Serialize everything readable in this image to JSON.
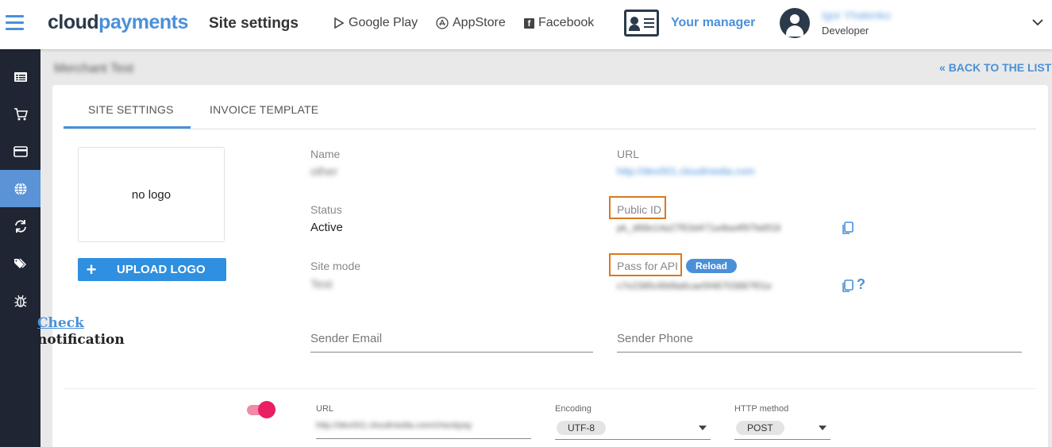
{
  "header": {
    "brand_part1": "cloud",
    "brand_part2": "payments",
    "page_title": "Site settings",
    "links": [
      {
        "label": "Google Play",
        "icon": "play-icon"
      },
      {
        "label": "AppStore",
        "icon": "appstore-icon"
      },
      {
        "label": "Facebook",
        "icon": "facebook-icon"
      }
    ],
    "manager_label": "Your manager",
    "user_name": "Igor Yhatenko",
    "user_role": "Developer"
  },
  "sidebar": {
    "items": [
      {
        "icon": "list-icon"
      },
      {
        "icon": "cart-icon"
      },
      {
        "icon": "card-icon"
      },
      {
        "icon": "globe-icon",
        "active": true
      },
      {
        "icon": "sync-icon"
      },
      {
        "icon": "tags-icon"
      },
      {
        "icon": "bug-icon"
      }
    ]
  },
  "page": {
    "merchant_name": "Merchant Test",
    "back_link": "BACK TO THE LIST"
  },
  "tabs": [
    {
      "label": "SITE SETTINGS",
      "active": true
    },
    {
      "label": "INVOICE TEMPLATE",
      "active": false
    }
  ],
  "logo": {
    "placeholder": "no logo",
    "upload_label": "UPLOAD LOGO"
  },
  "site": {
    "name_label": "Name",
    "name_value": "other",
    "url_label": "URL",
    "url_value": "http://dev001.cloudmedia.com",
    "status_label": "Status",
    "status_value": "Active",
    "public_id_label": "Public ID",
    "public_id_value": "pk_d68e14a27f53d471a4ba4f97fa6f18",
    "site_mode_label": "Site mode",
    "site_mode_value": "Test",
    "api_pass_label": "Pass for API",
    "reload_label": "Reload",
    "api_pass_value": "c7e2385c6fd9a6cae5f48703887f01e",
    "help_symbol": "?",
    "sender_email_placeholder": "Sender Email",
    "sender_phone_placeholder": "Sender Phone"
  },
  "check_notification": {
    "title_link": "Check",
    "title_rest": "notification",
    "enabled": true,
    "url_label": "URL",
    "url_value": "http://dev001.cloudmedia.com/checkpay",
    "encoding_label": "Encoding",
    "encoding_value": "UTF-8",
    "method_label": "HTTP method",
    "method_value": "POST"
  },
  "colors": {
    "accent": "#4a90d9",
    "sidebar_bg": "#1f2533",
    "sidebar_active": "#5b93d6",
    "highlight_box": "#d9791d",
    "toggle_on": "#e91e63",
    "button": "#2f8fe0"
  }
}
